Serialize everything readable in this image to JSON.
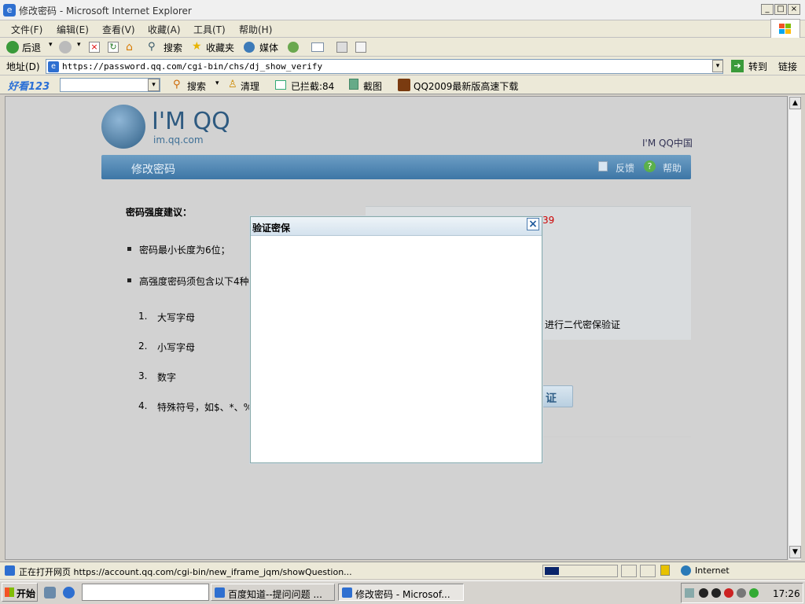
{
  "window": {
    "title": "修改密码 - Microsoft Internet Explorer"
  },
  "menu": [
    "文件(F)",
    "编辑(E)",
    "查看(V)",
    "收藏(A)",
    "工具(T)",
    "帮助(H)"
  ],
  "toolbar": {
    "back": "后退",
    "search": "搜索",
    "favorites": "收藏夹",
    "media": "媒体"
  },
  "address": {
    "label": "地址(D)",
    "url": "https://password.qq.com/cgi-bin/chs/dj_show_verify",
    "go": "转到",
    "links": "链接"
  },
  "linksbar": {
    "brand": "好看123",
    "search": "搜索",
    "clean": "清理",
    "blocked": "已拦截:84",
    "screenshot": "截图",
    "qq_download": "QQ2009最新版高速下载"
  },
  "page": {
    "logo_text": "I'M QQ",
    "logo_sub": "im.qq.com",
    "region_link": "I'M QQ中国",
    "banner_title": "修改密码",
    "feedback": "反馈",
    "help": "帮助",
    "strength_title": "密码强度建议：",
    "bullets": [
      "密码最小长度为6位；",
      "高强度密码须包含以下4种"
    ],
    "numbered": [
      "大写字母",
      "小写字母",
      "数字",
      "特殊符号，如$、*、%"
    ],
    "numbers": [
      "1.",
      "2.",
      "3.",
      "4."
    ],
    "right_partial_num": "39",
    "right_partial_text": "进行二代密保验证",
    "verify_btn": "证"
  },
  "modal": {
    "title": "验证密保",
    "close": "×"
  },
  "status": {
    "text": "正在打开网页 https://account.qq.com/cgi-bin/new_iframe_jqm/showQuestion...",
    "zone": "Internet"
  },
  "taskbar": {
    "start": "开始",
    "tasks": [
      "百度知道--提问问题 ...",
      "修改密码 - Microsof..."
    ],
    "clock": "17:26"
  }
}
